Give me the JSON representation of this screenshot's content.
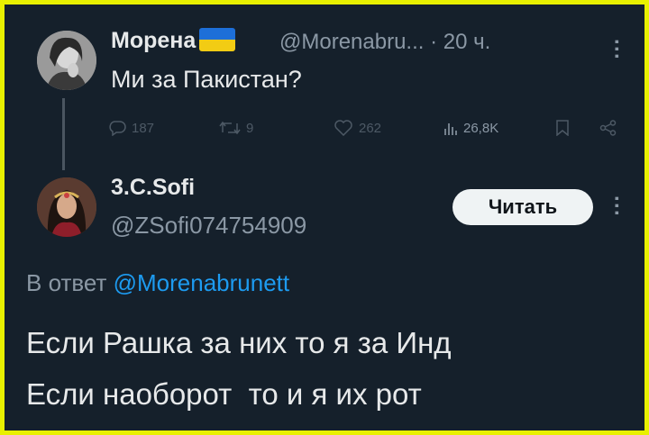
{
  "tweet1": {
    "name": "Морена",
    "handle": "@Morenabru...",
    "separator": "·",
    "time": "20 ч.",
    "text": "Ми за Пакистан?",
    "replies": "187",
    "retweets": "9",
    "likes": "262",
    "views": "26,8K"
  },
  "tweet2": {
    "name": "3.C.Sofi",
    "handle": "@ZSofi074754909",
    "follow_label": "Читать",
    "reply_prefix": "В ответ",
    "reply_to": "@Morenabrunett",
    "line1": "Если Рашка за них то я за Инд",
    "line2": "Если наоборот  то и я их рот"
  },
  "colors": {
    "background": "#15202b",
    "border": "#e8f000",
    "text": "#e7e9ea",
    "secondary": "#8b98a5",
    "link": "#1d9bf0"
  }
}
